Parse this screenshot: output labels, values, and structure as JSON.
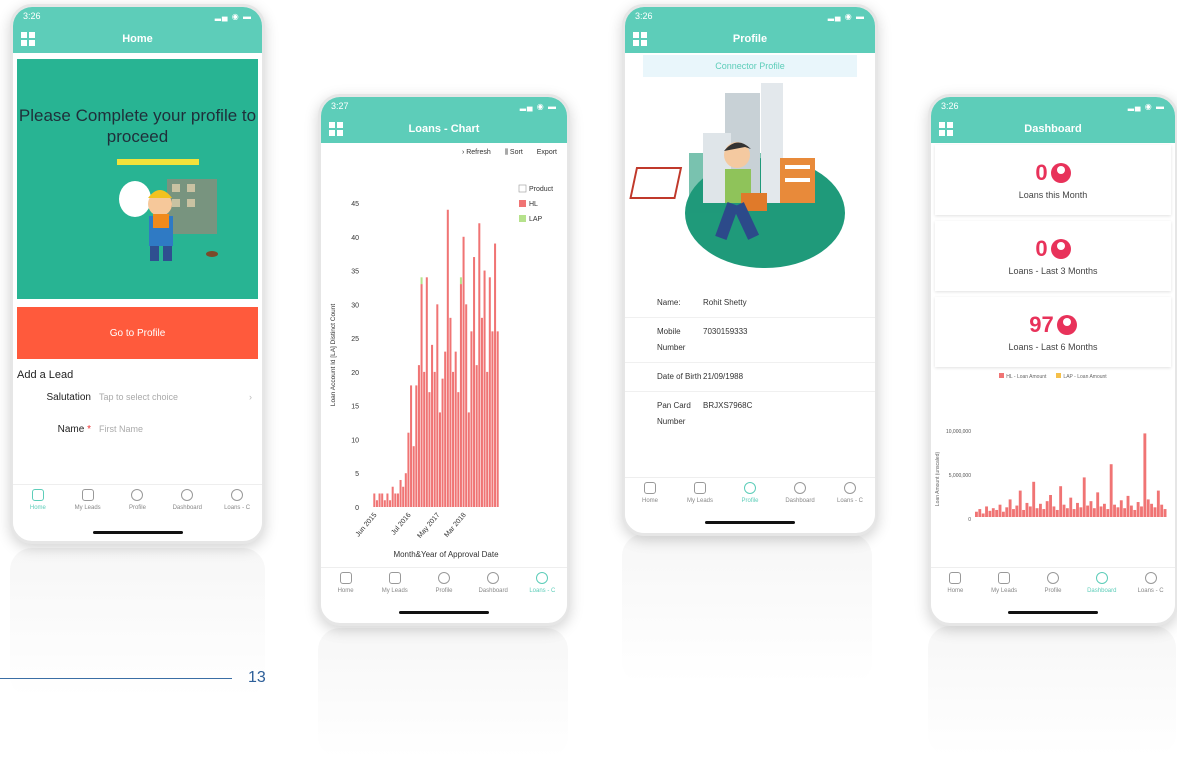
{
  "page_number": "13",
  "home": {
    "time": "3:26",
    "title": "Home",
    "banner_text": "Please Complete your profile to proceed",
    "cta": "Go to Profile",
    "form_title": "Add a Lead",
    "fields": [
      {
        "label": "Salutation",
        "value": "Tap to select choice"
      },
      {
        "label": "Name",
        "value": "First Name",
        "required": "*"
      }
    ],
    "active_tab": "Home"
  },
  "tabs": [
    "Home",
    "My Leads",
    "Profile",
    "Dashboard",
    "Loans - C"
  ],
  "chart_phone": {
    "time": "3:27",
    "title": "Loans - Chart",
    "toolbar": [
      "Refresh",
      "Sort",
      "Export"
    ],
    "legend_title": "Product",
    "active_tab": "Loans - C"
  },
  "chart_data": {
    "type": "bar",
    "ylabel": "Loan Account Id [LA] Distinct Count",
    "xlabel": "Month&Year of Approval Date",
    "ylim": [
      0,
      45
    ],
    "yticks": [
      0,
      5,
      10,
      15,
      20,
      25,
      30,
      35,
      40,
      45
    ],
    "xticks": [
      "Jun 2015",
      "Jul 2016",
      "May 2017",
      "Mar 2018"
    ],
    "series": [
      {
        "name": "HL",
        "color": "#f07474",
        "values": [
          2,
          1,
          2,
          2,
          1,
          2,
          1,
          3,
          2,
          2,
          4,
          3,
          5,
          11,
          18,
          9,
          18,
          21,
          33,
          20,
          34,
          17,
          24,
          20,
          30,
          14,
          19,
          23,
          44,
          28,
          20,
          23,
          17,
          33,
          40,
          30,
          14,
          26,
          37,
          21,
          42,
          28,
          35,
          20,
          34,
          26,
          39,
          26
        ]
      },
      {
        "name": "LAP",
        "color": "#b6e28c",
        "values": [
          0,
          0,
          0,
          0,
          0,
          0,
          0,
          0,
          0,
          0,
          0,
          0,
          0,
          0,
          0,
          0,
          0,
          0,
          1,
          0,
          0,
          0,
          0,
          0,
          0,
          0,
          0,
          0,
          0,
          0,
          0,
          0,
          0,
          1,
          0,
          0,
          0,
          0,
          0,
          0,
          0,
          0,
          0,
          0,
          0,
          0,
          0,
          0
        ]
      }
    ]
  },
  "profile": {
    "time": "3:26",
    "title": "Profile",
    "section": "Connector Profile",
    "rows": [
      {
        "k": "Name:",
        "v": "Rohit Shetty"
      },
      {
        "k": "Mobile Number",
        "v": "7030159333"
      },
      {
        "k": "Date of Birth",
        "v": "21/09/1988"
      },
      {
        "k": "Pan Card Number",
        "v": "BRJXS7968C"
      }
    ],
    "active_tab": "Profile"
  },
  "dashboard": {
    "time": "3:26",
    "title": "Dashboard",
    "cards": [
      {
        "value": "0",
        "caption": "Loans this Month"
      },
      {
        "value": "0",
        "caption": "Loans - Last 3 Months"
      },
      {
        "value": "97",
        "caption": "Loans - Last 6 Months"
      }
    ],
    "legend": [
      {
        "name": "HL - Loan Amount",
        "color": "#f07474"
      },
      {
        "name": "LAP - Loan Amount",
        "color": "#f5c04a"
      }
    ],
    "yticks": [
      "10,000,000",
      "5,000,000",
      "0"
    ],
    "ylabel": "Loan Amount (unscaled)",
    "active_tab": "Dashboard"
  },
  "colors": {
    "teal": "#5dcdb9",
    "orange": "#ff5a3c",
    "green": "#28b493",
    "pink": "#e8325a"
  }
}
